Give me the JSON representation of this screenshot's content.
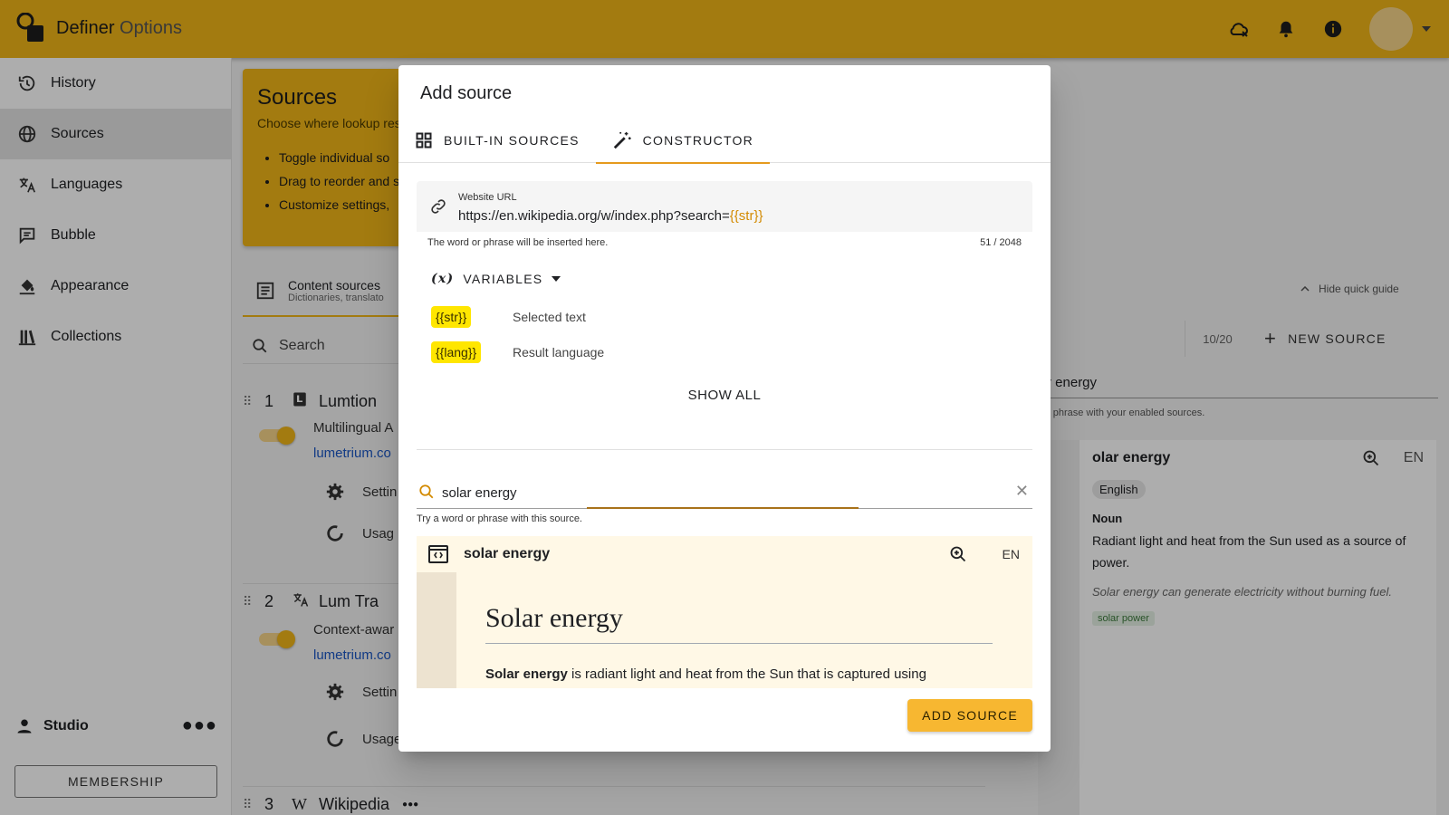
{
  "app": {
    "title": "Definer",
    "title_suffix": "Options"
  },
  "sidebar": {
    "items": [
      {
        "label": "History",
        "icon": "history-icon"
      },
      {
        "label": "Sources",
        "icon": "globe-icon",
        "active": true
      },
      {
        "label": "Languages",
        "icon": "translate-icon"
      },
      {
        "label": "Bubble",
        "icon": "bubble-icon"
      },
      {
        "label": "Appearance",
        "icon": "paint-bucket-icon"
      },
      {
        "label": "Collections",
        "icon": "library-icon"
      }
    ],
    "user": "Studio",
    "membership_label": "MEMBERSHIP"
  },
  "sources_page": {
    "title": "Sources",
    "description": "Choose where lookup res",
    "bullets": [
      "Toggle individual so",
      "Drag to reorder and s",
      "Customize settings, "
    ],
    "content_tab": {
      "label": "Content sources",
      "sub": "Dictionaries, translato"
    },
    "search_label": "Search",
    "items": [
      {
        "index": "1",
        "name": "Lumtion",
        "desc": "Multilingual A",
        "link": "lumetrium.co",
        "settings": "Settin",
        "usage": "Usag"
      },
      {
        "index": "2",
        "name": "Lum Tra",
        "desc": "Context-awar",
        "link": "lumetrium.co",
        "settings": "Settin",
        "usage": "Usage"
      },
      {
        "index": "3",
        "name": "Wikipedia"
      }
    ],
    "hide_guide": "Hide quick guide",
    "counter": "10/20",
    "new_source": "NEW SOURCE",
    "preview": {
      "input": "r energy",
      "hint": "r phrase with your enabled sources.",
      "title": "olar energy",
      "lang": "EN",
      "chip": "English",
      "pos": "Noun",
      "definition": "Radiant light and heat from the Sun used as a source of power.",
      "example": "Solar energy can generate electricity without burning fuel.",
      "tag": "solar power"
    }
  },
  "dialog": {
    "title": "Add source",
    "tabs": [
      {
        "label": "BUILT-IN SOURCES",
        "active": false
      },
      {
        "label": "CONSTRUCTOR",
        "active": true
      }
    ],
    "url_field": {
      "label": "Website URL",
      "value_prefix": "https://en.wikipedia.org/w/index.php?search=",
      "value_var": "{{str}}",
      "hint": "The word or phrase will be inserted here.",
      "count": "51 / 2048"
    },
    "variables": {
      "label": "VARIABLES",
      "items": [
        {
          "token": "{{str}}",
          "desc": "Selected text"
        },
        {
          "token": "{{lang}}",
          "desc": "Result language"
        }
      ],
      "show_all": "SHOW ALL"
    },
    "try_field": {
      "value": "solar energy",
      "hint": "Try a word or phrase with this source."
    },
    "result": {
      "name": "solar energy",
      "lang": "EN",
      "article_title": "Solar energy",
      "article_bold": "Solar energy",
      "article_rest": " is radiant light and heat from the Sun that is captured using"
    },
    "add_button": "ADD SOURCE"
  },
  "colors": {
    "accent": "#f0b519",
    "button": "#f7b731",
    "tab_indicator": "#e59a1d"
  }
}
